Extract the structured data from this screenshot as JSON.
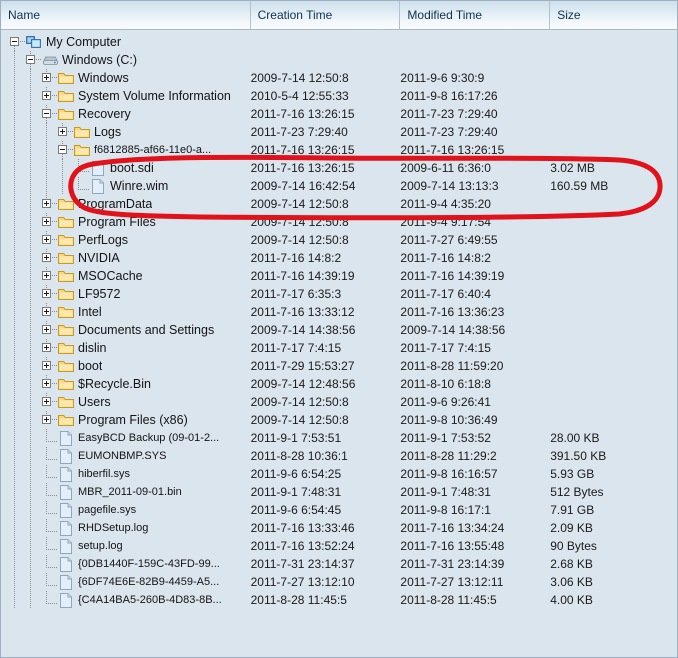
{
  "window": {
    "title": "File tree listing"
  },
  "columns": [
    {
      "key": "name",
      "label": "Name"
    },
    {
      "key": "ctime",
      "label": "Creation Time"
    },
    {
      "key": "mtime",
      "label": "Modified Time"
    },
    {
      "key": "size",
      "label": "Size"
    }
  ],
  "annotation": {
    "shape": "ellipse",
    "color": "#e11219",
    "targets": [
      "boot.sdi",
      "Winre.wim"
    ]
  },
  "rows": [
    {
      "name": "My Computer",
      "icon": "computer-icon",
      "depth": 0,
      "state": "expanded",
      "ctime": "",
      "mtime": "",
      "size": ""
    },
    {
      "name": "Windows (C:)",
      "icon": "drive-icon",
      "depth": 1,
      "state": "expanded",
      "ctime": "",
      "mtime": "",
      "size": ""
    },
    {
      "name": "Windows",
      "icon": "folder-icon",
      "depth": 2,
      "state": "collapsed",
      "ctime": "2009-7-14 12:50:8",
      "mtime": "2011-9-6 9:30:9",
      "size": ""
    },
    {
      "name": "System Volume Information",
      "icon": "folder-icon",
      "depth": 2,
      "state": "collapsed",
      "ctime": "2010-5-4 12:55:33",
      "mtime": "2011-9-8 16:17:26",
      "size": ""
    },
    {
      "name": "Recovery",
      "icon": "folder-icon",
      "depth": 2,
      "state": "expanded",
      "ctime": "2011-7-16 13:26:15",
      "mtime": "2011-7-23 7:29:40",
      "size": ""
    },
    {
      "name": "Logs",
      "icon": "folder-icon",
      "depth": 3,
      "state": "collapsed",
      "ctime": "2011-7-23 7:29:40",
      "mtime": "2011-7-23 7:29:40",
      "size": ""
    },
    {
      "name": "f6812885-af66-11e0-a...",
      "icon": "folder-icon",
      "depth": 3,
      "state": "expanded",
      "ctime": "2011-7-16 13:26:15",
      "mtime": "2011-7-16 13:26:15",
      "size": "",
      "small": true
    },
    {
      "name": "boot.sdi",
      "icon": "file-icon",
      "depth": 4,
      "state": "leaf",
      "ctime": "2011-7-16 13:26:15",
      "mtime": "2009-6-11 6:36:0",
      "size": "3.02 MB"
    },
    {
      "name": "Winre.wim",
      "icon": "file-icon",
      "depth": 4,
      "state": "leaf-last",
      "ctime": "2009-7-14 16:42:54",
      "mtime": "2009-7-14 13:13:3",
      "size": "160.59 MB"
    },
    {
      "name": "ProgramData",
      "icon": "folder-icon",
      "depth": 2,
      "state": "collapsed",
      "ctime": "2009-7-14 12:50:8",
      "mtime": "2011-9-4 4:35:20",
      "size": ""
    },
    {
      "name": "Program Files",
      "icon": "folder-icon",
      "depth": 2,
      "state": "collapsed",
      "ctime": "2009-7-14 12:50:8",
      "mtime": "2011-9-4 9:17:54",
      "size": ""
    },
    {
      "name": "PerfLogs",
      "icon": "folder-icon",
      "depth": 2,
      "state": "collapsed",
      "ctime": "2009-7-14 12:50:8",
      "mtime": "2011-7-27 6:49:55",
      "size": ""
    },
    {
      "name": "NVIDIA",
      "icon": "folder-icon",
      "depth": 2,
      "state": "collapsed",
      "ctime": "2011-7-16 14:8:2",
      "mtime": "2011-7-16 14:8:2",
      "size": ""
    },
    {
      "name": "MSOCache",
      "icon": "folder-icon",
      "depth": 2,
      "state": "collapsed",
      "ctime": "2011-7-16 14:39:19",
      "mtime": "2011-7-16 14:39:19",
      "size": ""
    },
    {
      "name": "LF9572",
      "icon": "folder-icon",
      "depth": 2,
      "state": "collapsed",
      "ctime": "2011-7-17 6:35:3",
      "mtime": "2011-7-17 6:40:4",
      "size": ""
    },
    {
      "name": "Intel",
      "icon": "folder-icon",
      "depth": 2,
      "state": "collapsed",
      "ctime": "2011-7-16 13:33:12",
      "mtime": "2011-7-16 13:36:23",
      "size": ""
    },
    {
      "name": "Documents and Settings",
      "icon": "folder-icon",
      "depth": 2,
      "state": "collapsed",
      "ctime": "2009-7-14 14:38:56",
      "mtime": "2009-7-14 14:38:56",
      "size": ""
    },
    {
      "name": "dislin",
      "icon": "folder-icon",
      "depth": 2,
      "state": "collapsed",
      "ctime": "2011-7-17 7:4:15",
      "mtime": "2011-7-17 7:4:15",
      "size": ""
    },
    {
      "name": "boot",
      "icon": "folder-icon",
      "depth": 2,
      "state": "collapsed",
      "ctime": "2011-7-29 15:53:27",
      "mtime": "2011-8-28 11:59:20",
      "size": ""
    },
    {
      "name": "$Recycle.Bin",
      "icon": "folder-icon",
      "depth": 2,
      "state": "collapsed",
      "ctime": "2009-7-14 12:48:56",
      "mtime": "2011-8-10 6:18:8",
      "size": ""
    },
    {
      "name": "Users",
      "icon": "folder-icon",
      "depth": 2,
      "state": "collapsed",
      "ctime": "2009-7-14 12:50:8",
      "mtime": "2011-9-6 9:26:41",
      "size": ""
    },
    {
      "name": "Program Files (x86)",
      "icon": "folder-icon",
      "depth": 2,
      "state": "collapsed",
      "ctime": "2009-7-14 12:50:8",
      "mtime": "2011-9-8 10:36:49",
      "size": ""
    },
    {
      "name": "EasyBCD Backup (09-01-2...",
      "icon": "file-icon",
      "depth": 2,
      "state": "leaf",
      "ctime": "2011-9-1 7:53:51",
      "mtime": "2011-9-1 7:53:52",
      "size": "28.00 KB",
      "small": true
    },
    {
      "name": "EUMONBMP.SYS",
      "icon": "file-icon",
      "depth": 2,
      "state": "leaf",
      "ctime": "2011-8-28 10:36:1",
      "mtime": "2011-8-28 11:29:2",
      "size": "391.50 KB",
      "small": true
    },
    {
      "name": "hiberfil.sys",
      "icon": "file-icon",
      "depth": 2,
      "state": "leaf",
      "ctime": "2011-9-6 6:54:25",
      "mtime": "2011-9-8 16:16:57",
      "size": "5.93 GB",
      "small": true
    },
    {
      "name": "MBR_2011-09-01.bin",
      "icon": "file-icon",
      "depth": 2,
      "state": "leaf",
      "ctime": "2011-9-1 7:48:31",
      "mtime": "2011-9-1 7:48:31",
      "size": "512 Bytes",
      "small": true
    },
    {
      "name": "pagefile.sys",
      "icon": "file-icon",
      "depth": 2,
      "state": "leaf",
      "ctime": "2011-9-6 6:54:45",
      "mtime": "2011-9-8 16:17:1",
      "size": "7.91 GB",
      "small": true
    },
    {
      "name": "RHDSetup.log",
      "icon": "file-icon",
      "depth": 2,
      "state": "leaf",
      "ctime": "2011-7-16 13:33:46",
      "mtime": "2011-7-16 13:34:24",
      "size": "2.09 KB",
      "small": true
    },
    {
      "name": "setup.log",
      "icon": "file-icon",
      "depth": 2,
      "state": "leaf",
      "ctime": "2011-7-16 13:52:24",
      "mtime": "2011-7-16 13:55:48",
      "size": "90 Bytes",
      "small": true
    },
    {
      "name": "{0DB1440F-159C-43FD-99...",
      "icon": "file-icon",
      "depth": 2,
      "state": "leaf",
      "ctime": "2011-7-31 23:14:37",
      "mtime": "2011-7-31 23:14:39",
      "size": "2.68 KB",
      "small": true
    },
    {
      "name": "{6DF74E6E-82B9-4459-A5...",
      "icon": "file-icon",
      "depth": 2,
      "state": "leaf",
      "ctime": "2011-7-27 13:12:10",
      "mtime": "2011-7-27 13:12:11",
      "size": "3.06 KB",
      "small": true
    },
    {
      "name": "{C4A14BA5-260B-4D83-8B...",
      "icon": "file-icon",
      "depth": 2,
      "state": "leaf-last",
      "ctime": "2011-8-28 11:45:5",
      "mtime": "2011-8-28 11:45:5",
      "size": "4.00 KB",
      "small": true
    }
  ]
}
